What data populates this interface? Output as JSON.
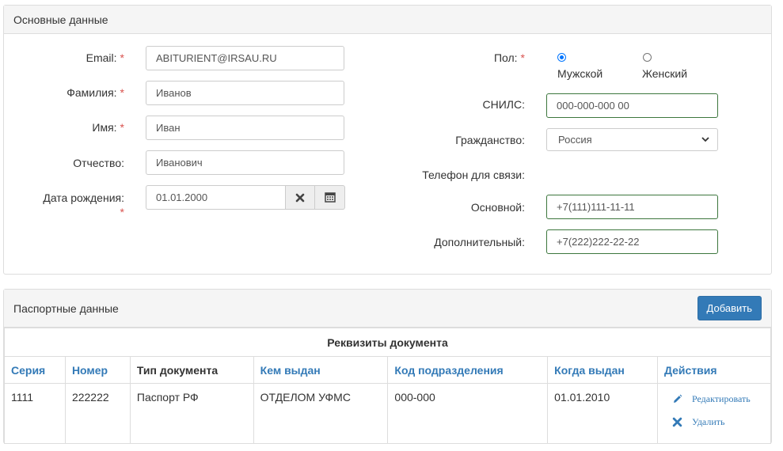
{
  "main_panel": {
    "title": "Основные данные",
    "fields": {
      "email": {
        "label": "Email:",
        "value": "ABITURIENT@IRSAU.RU"
      },
      "last_name": {
        "label": "Фамилия:",
        "value": "Иванов"
      },
      "first_name": {
        "label": "Имя:",
        "value": "Иван"
      },
      "patronymic": {
        "label": "Отчество:",
        "value": "Иванович"
      },
      "birth_date": {
        "label": "Дата рождения:",
        "value": "01.01.2000"
      },
      "gender": {
        "label": "Пол:",
        "options": [
          "Мужской",
          "Женский"
        ],
        "selected": "Мужской"
      },
      "snils": {
        "label": "СНИЛС:",
        "value": "000-000-000 00"
      },
      "citizenship": {
        "label": "Гражданство:",
        "value": "Россия"
      },
      "phone_heading": "Телефон для связи:",
      "phone_main": {
        "label": "Основной:",
        "value": "+7(111)111-11-11"
      },
      "phone_extra": {
        "label": "Дополнительный:",
        "value": "+7(222)222-22-22"
      }
    },
    "required_mark": "*"
  },
  "passport_panel": {
    "title": "Паспортные данные",
    "add_button": "Добавить",
    "table": {
      "group_header": "Реквизиты документа",
      "columns": [
        "Серия",
        "Номер",
        "Тип документа",
        "Кем выдан",
        "Код подразделения",
        "Когда выдан",
        "Действия"
      ],
      "rows": [
        {
          "series": "1111",
          "number": "222222",
          "doc_type": "Паспорт РФ",
          "issued_by": "ОТДЕЛОМ УФМС",
          "division_code": "000-000",
          "issued_date": "01.01.2010"
        }
      ],
      "actions": {
        "edit": "Редактировать",
        "delete": "Удалить"
      }
    }
  },
  "colors": {
    "primary": "#337ab7",
    "required": "#d9534f",
    "valid_border": "#3c763d",
    "radio": "#0075ff"
  },
  "icons": [
    "clear-icon",
    "calendar-icon",
    "chevron-down-icon",
    "pencil-icon",
    "close-icon"
  ]
}
